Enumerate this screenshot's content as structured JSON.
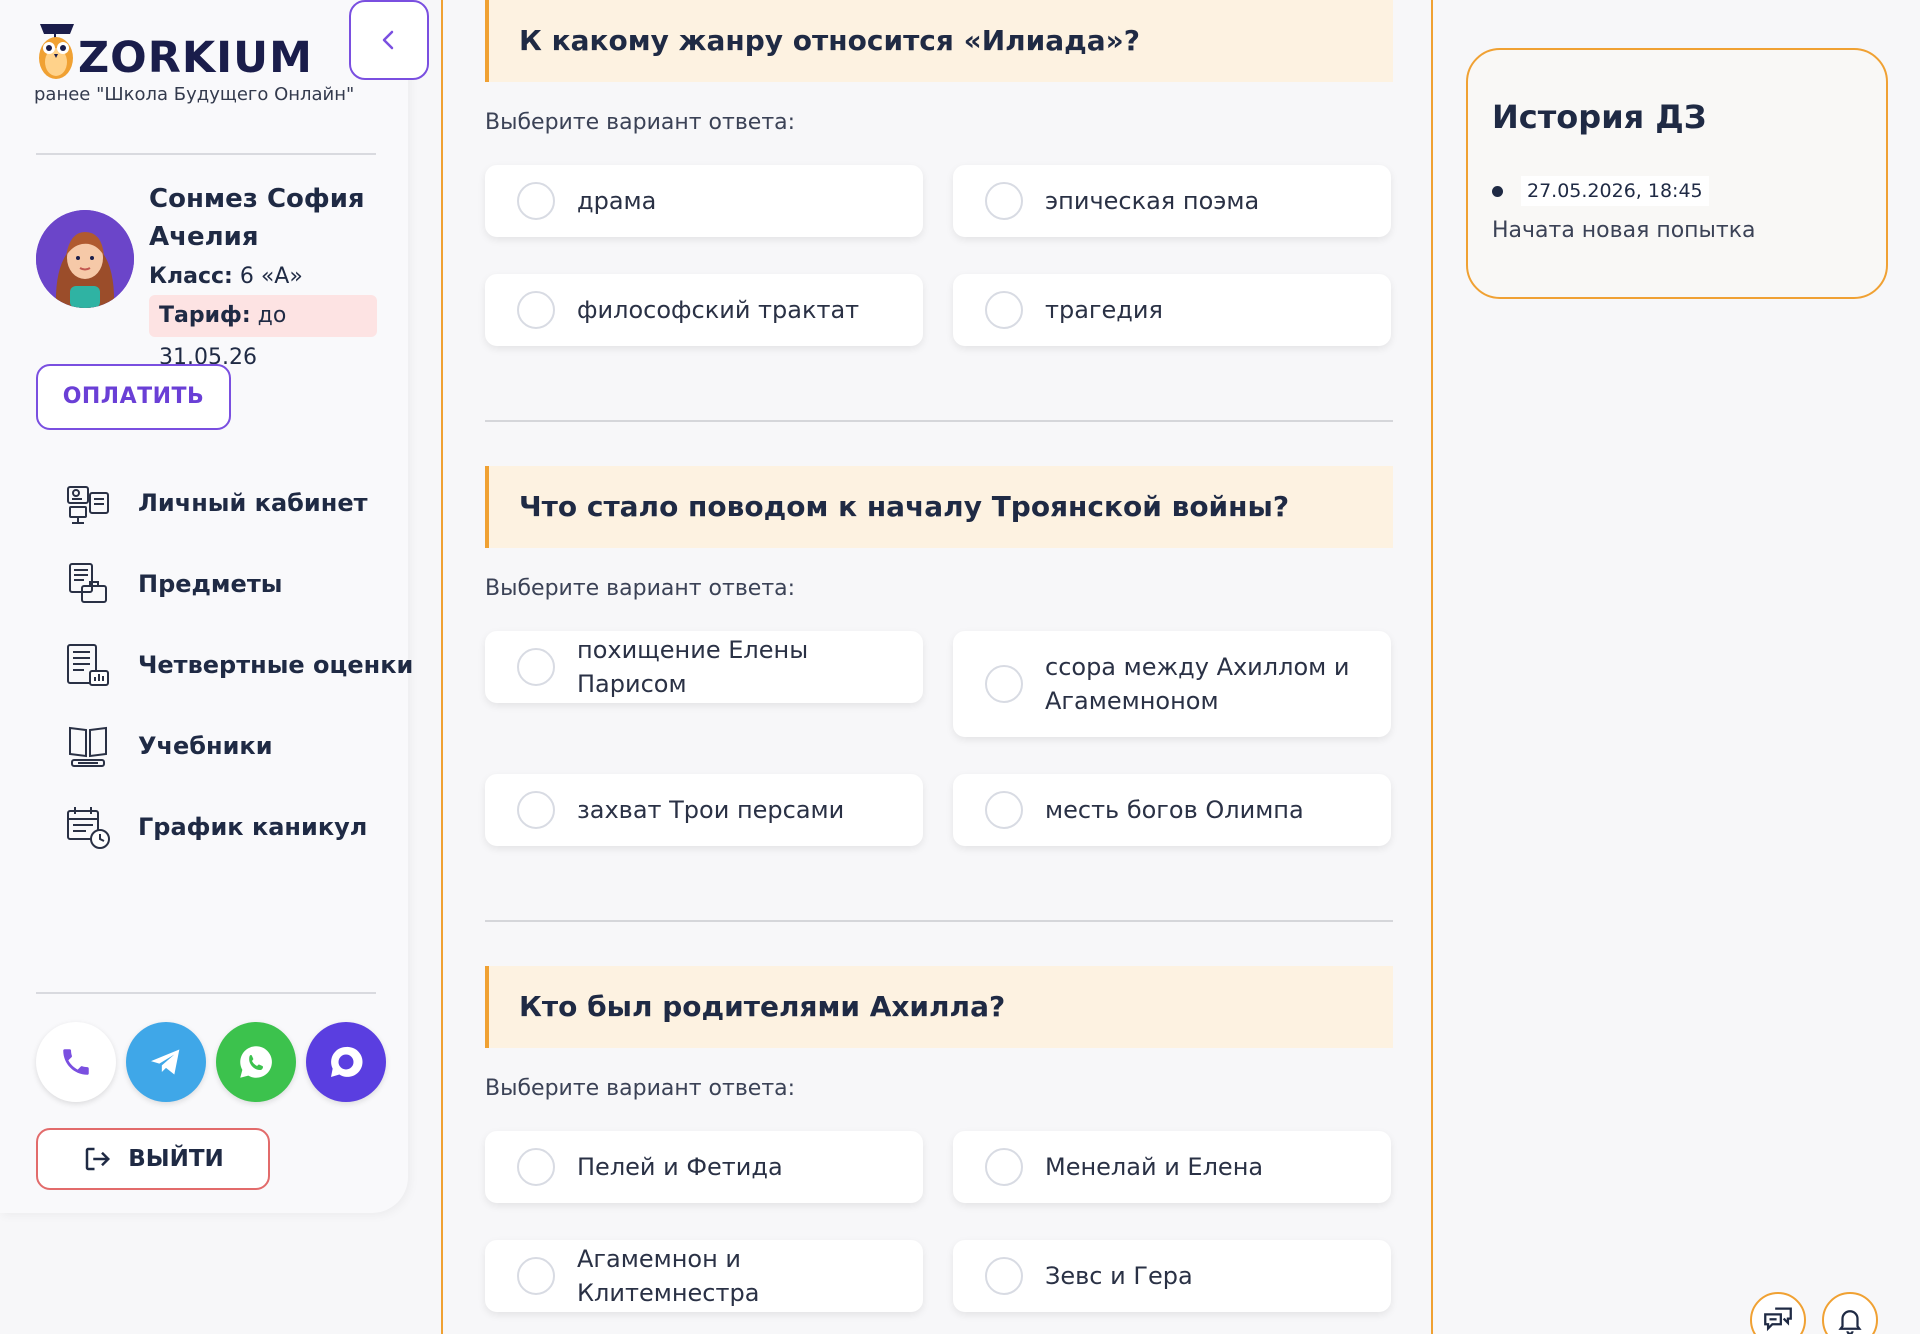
{
  "brand": {
    "name": "ZORKIUM",
    "subtitle": "ранее \"Школа Будущего Онлайн\""
  },
  "user": {
    "name": "Сонмез София Ачелия",
    "class_label": "Класс:",
    "class_value": "6 «А»",
    "tariff_label": "Тариф:",
    "tariff_value": "до 31.05.26"
  },
  "sidebar": {
    "pay_label": "ОПЛАТИТЬ",
    "items": [
      {
        "label": "Личный кабинет",
        "icon": "dashboard-icon"
      },
      {
        "label": "Предметы",
        "icon": "subjects-icon"
      },
      {
        "label": "Четвертные оценки",
        "icon": "grades-icon"
      },
      {
        "label": "Учебники",
        "icon": "book-icon"
      },
      {
        "label": "График каникул",
        "icon": "calendar-icon"
      }
    ],
    "logout_label": "ВЫЙТИ"
  },
  "questions": [
    {
      "title": "К какому жанру относится «Илиада»?",
      "subtitle": "Выберите вариант ответа:",
      "options": [
        "драма",
        "эпическая поэма",
        "философский трактат",
        "трагедия"
      ]
    },
    {
      "title": "Что стало поводом к началу Троянской войны?",
      "subtitle": "Выберите вариант ответа:",
      "options": [
        "похищение Елены Парисом",
        "ссора между Ахиллом и Агамемноном",
        "захват Трои персами",
        "месть богов Олимпа"
      ]
    },
    {
      "title": "Кто был родителями Ахилла?",
      "subtitle": "Выберите вариант ответа:",
      "options": [
        "Пелей и Фетида",
        "Менелай и Елена",
        "Агамемнон и Клитемнестра",
        "Зевс и Гера"
      ]
    }
  ],
  "history": {
    "title": "История ДЗ",
    "entries": [
      {
        "date": "27.05.2026, 18:45",
        "event": "Начата новая попытка"
      }
    ]
  },
  "colors": {
    "accent_orange": "#f0a133",
    "accent_purple": "#7a4fe0",
    "question_bg": "#fdf2e1"
  }
}
